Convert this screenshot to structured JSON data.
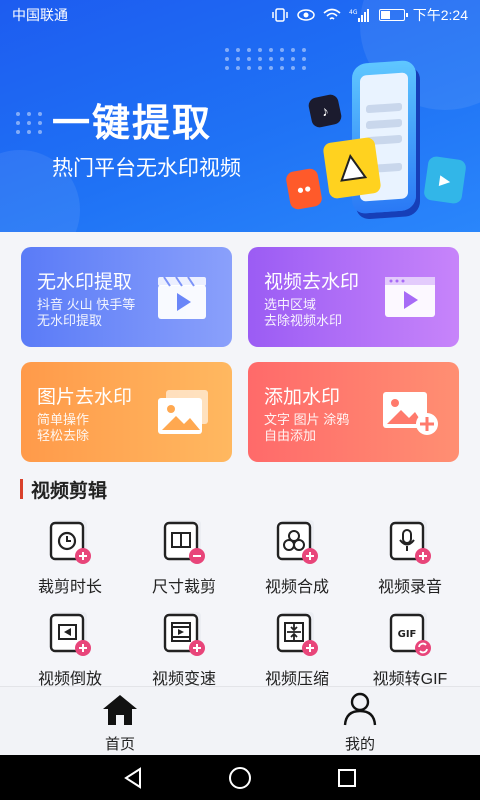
{
  "status_bar": {
    "carrier": "中国联通",
    "time": "下午2:24"
  },
  "banner": {
    "title": "一键提取",
    "subtitle": "热门平台无水印视频"
  },
  "feature_cards": [
    {
      "title": "无水印提取",
      "desc_line1": "抖音 火山 快手等",
      "desc_line2": "无水印提取"
    },
    {
      "title": "视频去水印",
      "desc_line1": "选中区域",
      "desc_line2": "去除视频水印"
    },
    {
      "title": "图片去水印",
      "desc_line1": "简单操作",
      "desc_line2": "轻松去除"
    },
    {
      "title": "添加水印",
      "desc_line1": "文字 图片 涂鸦",
      "desc_line2": "自由添加"
    }
  ],
  "section": {
    "title": "视频剪辑"
  },
  "tools": [
    {
      "label": "裁剪时长",
      "icon": "trim-duration-icon",
      "badge": "+"
    },
    {
      "label": "尺寸裁剪",
      "icon": "crop-size-icon",
      "badge": "−"
    },
    {
      "label": "视频合成",
      "icon": "merge-video-icon",
      "badge": "+"
    },
    {
      "label": "视频录音",
      "icon": "record-audio-icon",
      "badge": "+"
    },
    {
      "label": "视频倒放",
      "icon": "reverse-video-icon",
      "badge": "+"
    },
    {
      "label": "视频变速",
      "icon": "speed-video-icon",
      "badge": "+"
    },
    {
      "label": "视频压缩",
      "icon": "compress-video-icon",
      "badge": "+"
    },
    {
      "label": "视频转GIF",
      "icon": "video-to-gif-icon",
      "badge": "⟳",
      "icon_text": "GIF"
    }
  ],
  "bottom_nav": [
    {
      "label": "首页",
      "icon": "home-icon"
    },
    {
      "label": "我的",
      "icon": "profile-icon"
    }
  ],
  "colors": {
    "banner": "#1f6ef3",
    "badge": "#e8457a",
    "section_bar": "#d9412c"
  }
}
